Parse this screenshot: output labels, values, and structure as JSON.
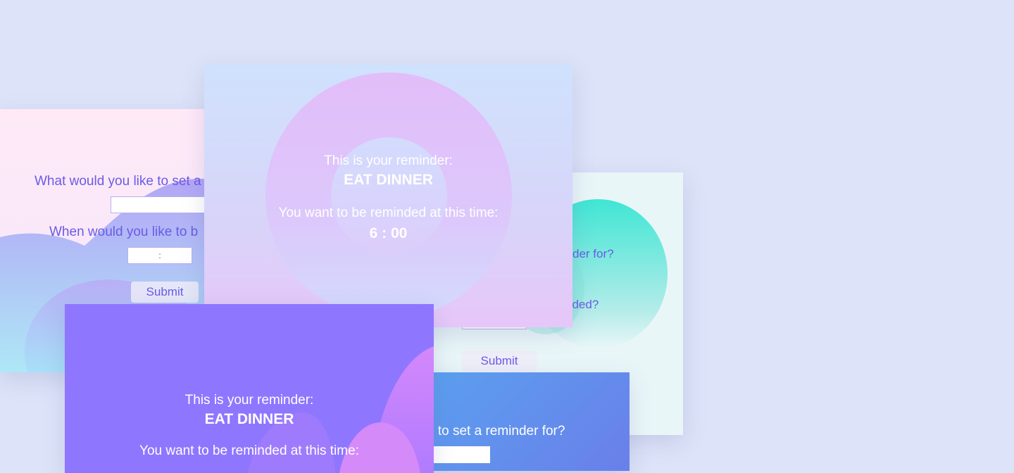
{
  "form_card_left": {
    "question_what": "What would you like to set a",
    "question_when": "When would you like to b",
    "time_placeholder": ":",
    "submit_label": "Submit"
  },
  "form_card_right": {
    "question_what_fragment": "der for?",
    "question_when_fragment": "nded?",
    "submit_label": "Submit"
  },
  "reminder_card_top": {
    "heading": "This is your reminder:",
    "reminder_text": "EAT DINNER",
    "time_heading": "You want to be reminded at this time:",
    "time_value": "6 : 00"
  },
  "reminder_card_bottom": {
    "heading": "This is your reminder:",
    "reminder_text": "EAT DINNER",
    "time_heading": "You want to be reminded at this time:"
  },
  "form_card_blue": {
    "question_what_fragment": "e to set a reminder for?"
  }
}
